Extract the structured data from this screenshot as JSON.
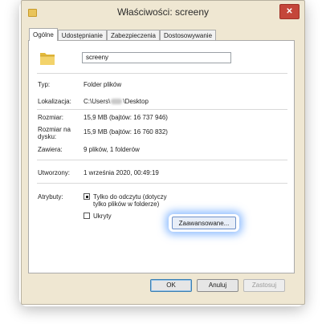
{
  "window": {
    "title": "Właściwości: screeny",
    "close_symbol": "✕"
  },
  "tabs": [
    {
      "label": "Ogólne",
      "active": true
    },
    {
      "label": "Udostępnianie",
      "active": false
    },
    {
      "label": "Zabezpieczenia",
      "active": false
    },
    {
      "label": "Dostosowywanie",
      "active": false
    }
  ],
  "general": {
    "folder_icon": "folder-icon",
    "name_value": "screeny",
    "type_label": "Typ:",
    "type_value": "Folder plików",
    "location_label": "Lokalizacja:",
    "location_prefix": "C:\\Users\\",
    "location_suffix": "\\Desktop",
    "size_label": "Rozmiar:",
    "size_value": "15,9 MB (bajtów: 16 737 946)",
    "disk_size_label_line1": "Rozmiar na",
    "disk_size_label_line2": "dysku:",
    "disk_size_value": "15,9 MB (bajtów: 16 760 832)",
    "contains_label": "Zawiera:",
    "contains_value": "9 plików, 1 folderów",
    "created_label": "Utworzony:",
    "created_value": "1 września 2020, 00:49:19",
    "attributes_label": "Atrybuty:",
    "readonly_label_line1": "Tylko do odczytu (dotyczy",
    "readonly_label_line2": "tylko plików w folderze)",
    "readonly_state": "indeterminate",
    "hidden_label": "Ukryty",
    "hidden_state": "unchecked",
    "advanced_button": "Zaawansowane..."
  },
  "footer": {
    "ok": "OK",
    "cancel": "Anuluj",
    "apply": "Zastosuj",
    "apply_enabled": false
  }
}
